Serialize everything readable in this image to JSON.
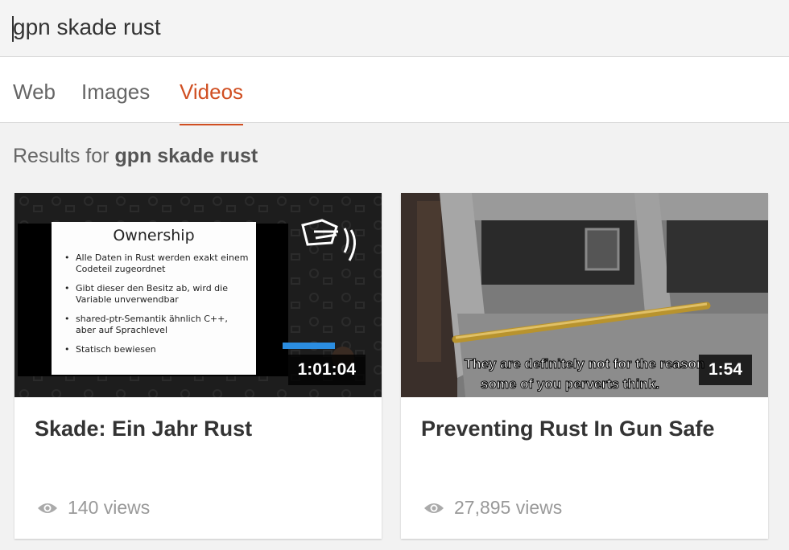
{
  "search": {
    "query": "gpn skade rust"
  },
  "tabs": [
    {
      "label": "Web",
      "active": false
    },
    {
      "label": "Images",
      "active": false
    },
    {
      "label": "Videos",
      "active": true
    }
  ],
  "results": {
    "prefix": "Results for",
    "query": "gpn skade rust"
  },
  "videos": [
    {
      "title": "Skade: Ein Jahr Rust",
      "duration": "1:01:04",
      "views": "140 views",
      "slide": {
        "heading": "Ownership",
        "bullets": [
          "Alle Daten in Rust werden exakt einem Codeteil zugeordnet",
          "Gibt dieser den Besitz ab, wird die Variable unverwendbar",
          "shared-ptr-Semantik ähnlich C++, aber auf Sprachlevel",
          "Statisch bewiesen"
        ]
      }
    },
    {
      "title": "Preventing Rust In Gun Safe",
      "duration": "1:54",
      "views": "27,895 views",
      "subtitle_line1": "They are definitely not for the reason",
      "subtitle_line2": "some of you perverts think."
    }
  ],
  "colors": {
    "accent": "#d04f22",
    "text": "#333333",
    "muted": "#999999"
  },
  "icons": {
    "views": "eye-icon"
  }
}
